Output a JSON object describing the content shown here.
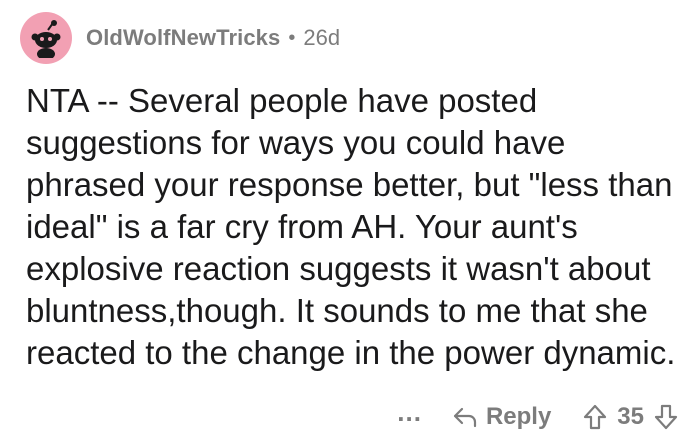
{
  "comment": {
    "author": "OldWolfNewTricks",
    "separator": "•",
    "age": "26d",
    "text": "NTA -- Several people have posted suggestions for ways you could have phrased your response better, but \"less than ideal\" is a far cry from AH. Your aunt's explosive reaction suggests it wasn't about bluntness,though. It sounds to me that she reacted to the change in the power dynamic."
  },
  "actions": {
    "more_label": "...",
    "reply_label": "Reply",
    "score": "35"
  },
  "icons": {
    "avatar": "reddit-snoo-avatar",
    "reply": "reply-arrow-icon",
    "upvote": "upvote-arrow-icon",
    "downvote": "downvote-arrow-icon"
  },
  "colors": {
    "avatar_bg": "#f2a0b3",
    "meta_text": "#7c7c7c",
    "body_text": "#1a1a1b"
  }
}
